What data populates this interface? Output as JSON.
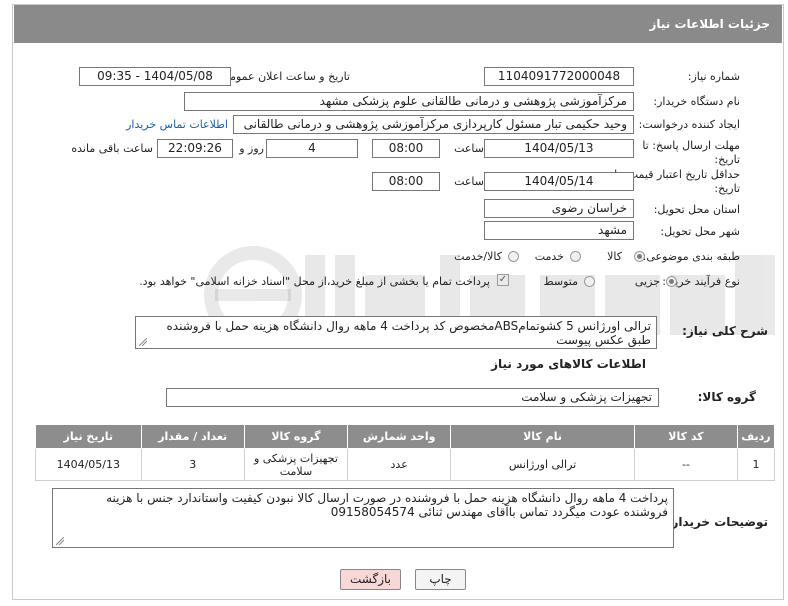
{
  "header": {
    "title": "جزئیات اطلاعات نیاز"
  },
  "fields": {
    "need_number_label": "شماره نیاز:",
    "need_number": "1104091772000048",
    "announce_label": "تاریخ و ساعت اعلان عمومی:",
    "announce_value": "1404/05/08 - 09:35",
    "buyer_org_label": "نام دستگاه خریدار:",
    "buyer_org": "مرکزآموزشی  پژوهشی و درمانی طالقانی   علوم پزشکی مشهد",
    "creator_label": "ایجاد کننده درخواست:",
    "creator": "وحید حکیمی تبار مسئول کارپردازی مرکزآموزشی  پژوهشی و درمانی طالقانی",
    "contact_link": "اطلاعات تماس خریدار",
    "reply_deadline_label": "مهلت ارسال پاسخ: تا تاریخ:",
    "reply_date": "1404/05/13",
    "time_label": "ساعت",
    "reply_time": "08:00",
    "days_value": "4",
    "days_label": "روز و",
    "remaining_time": "22:09:26",
    "remaining_label": "ساعت باقی مانده",
    "price_validity_label": "حداقل تاریخ اعتبار قیمت: تا تاریخ:",
    "price_date": "1404/05/14",
    "price_time": "08:00",
    "province_label": "استان محل تحویل:",
    "province": "خراسان رضوی",
    "city_label": "شهر محل تحویل:",
    "city": "مشهد",
    "category_label": "طبقه بندی موضوعی:",
    "category_options": [
      "کالا",
      "خدمت",
      "کالا/خدمت"
    ],
    "category_selected": "کالا",
    "process_label": "نوع فرآیند خرید :",
    "process_options": [
      "جزیی",
      "متوسط"
    ],
    "process_selected": "جزیی",
    "payment_note": "پرداخت تمام یا بخشی از مبلغ خرید،از محل \"اسناد خزانه اسلامی\" خواهد بود."
  },
  "description": {
    "label": "شرح کلی نیاز:",
    "text": "ترالی اورژانس 5 کشوتمامABSمخصوص کد پرداخت 4 ماهه روال دانشگاه هزینه حمل با فروشنده طبق عکس پیوست"
  },
  "goods": {
    "section_title": "اطلاعات کالاهای مورد نیاز",
    "group_label": "گروه کالا:",
    "group_value": "تجهیزات پزشکی و سلامت"
  },
  "table": {
    "headers": [
      "ردیف",
      "کد کالا",
      "نام کالا",
      "واحد شمارش",
      "گروه کالا",
      "تعداد / مقدار",
      "تاریخ نیاز"
    ],
    "rows": [
      [
        "1",
        "--",
        "ترالی اورژانس",
        "عدد",
        "تجهیزات پزشکی و سلامت",
        "3",
        "1404/05/13"
      ]
    ]
  },
  "buyer_notes": {
    "label": "توضیحات خریدار:",
    "text": "پرداخت 4 ماهه روال دانشگاه هزینه حمل با فروشنده در صورت ارسال کالا نبودن کیفیت واستاندارد جنس با هزینه فروشنده عودت میگردد تماس باآقای مهندس ثنائی 09158054574"
  },
  "buttons": {
    "print": "چاپ",
    "back": "بازگشت"
  },
  "colors": {
    "header_bg": "#8a8a8a",
    "link": "#1a5ea8",
    "back_btn_bg": "#f8d7d7"
  }
}
